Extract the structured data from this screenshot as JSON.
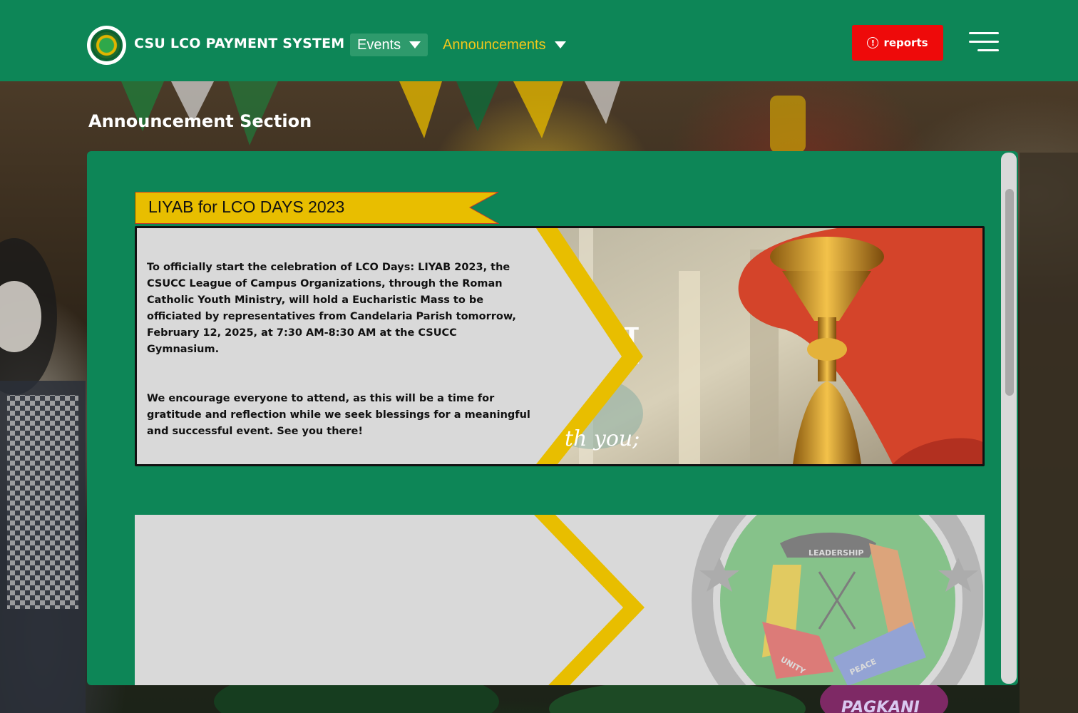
{
  "header": {
    "brand": "CSU LCO PAYMENT SYSTEM",
    "nav": {
      "events_label": "Events",
      "announcements_label": "Announcements"
    },
    "reports_label": "reports",
    "colors": {
      "header_bg": "#0d8657",
      "announcements": "#f2c81a",
      "reports_bg": "#ee0a0a"
    }
  },
  "section": {
    "title": "Announcement Section"
  },
  "announcements": [
    {
      "title": "LIYAB for LCO DAYS 2023",
      "paragraphs": [
        "To officially start the celebration of LCO Days: LIYAB 2023, the CSUCC League of Campus Organizations, through the Roman Catholic Youth Ministry, will hold a Eucharistic Mass to be officiated by representatives from Candelaria Parish tomorrow, February 12, 2025, at 7:30 AM-8:30 AM at the CSUCC Gymnasium.",
        "We encourage everyone to attend, as this will be a time for gratitude and reflection while we seek blessings for a meaningful and successful event. See you there!"
      ],
      "image_caption": "th you;"
    },
    {
      "title": "",
      "paragraphs": [],
      "emblem_labels": [
        "LEADERSHIP",
        "UNITY",
        "PEACE"
      ]
    }
  ],
  "background_caption": "PAGKANI",
  "icons": {
    "events_caret": "caret-down-icon",
    "announcements_caret": "caret-down-icon",
    "reports": "alert-circle-icon",
    "menu": "hamburger-menu-icon"
  }
}
